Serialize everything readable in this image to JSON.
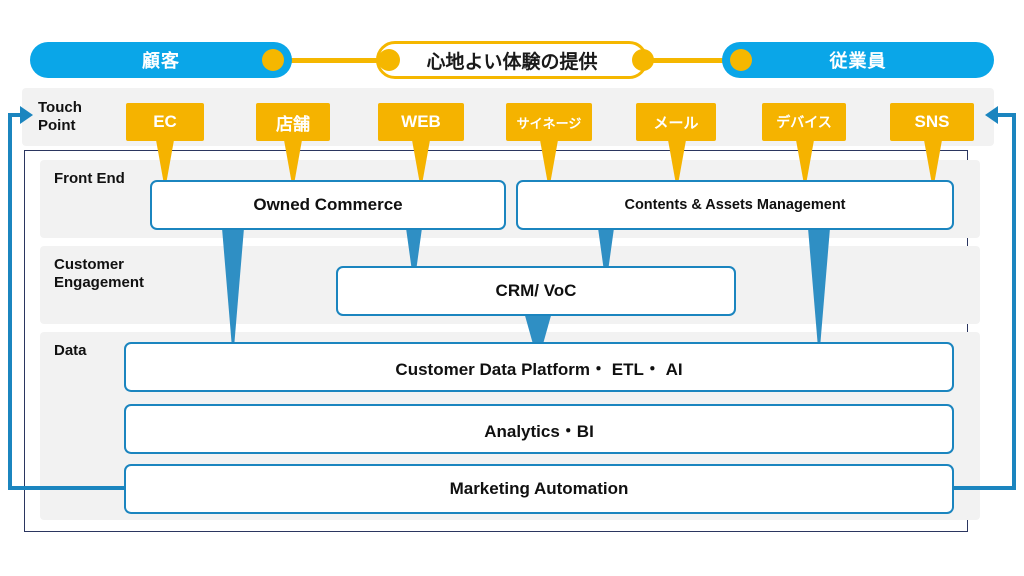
{
  "header": {
    "left_pill": "顧客",
    "center_label": "心地よい体験の提供",
    "right_pill": "従業員"
  },
  "colors": {
    "pill_blue": "#0aa6e8",
    "accent_yellow": "#f5b700",
    "touchpoint_yellow": "#f5b300",
    "box_blue": "#1b85bf",
    "arrow_blue": "#2f8fc4",
    "frame_navy": "#2b3660",
    "band_gray": "#f2f2f2"
  },
  "touch_point": {
    "label": "Touch\nPoint",
    "items": [
      {
        "label": "EC"
      },
      {
        "label": "店舗"
      },
      {
        "label": "WEB"
      },
      {
        "label": "サイネージ"
      },
      {
        "label": "メール"
      },
      {
        "label": "デバイス"
      },
      {
        "label": "SNS"
      }
    ]
  },
  "layers": [
    {
      "label": "Front End",
      "boxes": [
        {
          "label": "Owned Commerce"
        },
        {
          "label": "Contents & Assets Management"
        }
      ]
    },
    {
      "label": "Customer\nEngagement",
      "boxes": [
        {
          "label": "CRM/ VoC"
        }
      ]
    },
    {
      "label": "Data",
      "boxes": [
        {
          "label": "Customer Data Platform・ ETL・ AI"
        },
        {
          "label": "Analytics・BI"
        },
        {
          "label": "Marketing Automation"
        }
      ]
    }
  ]
}
